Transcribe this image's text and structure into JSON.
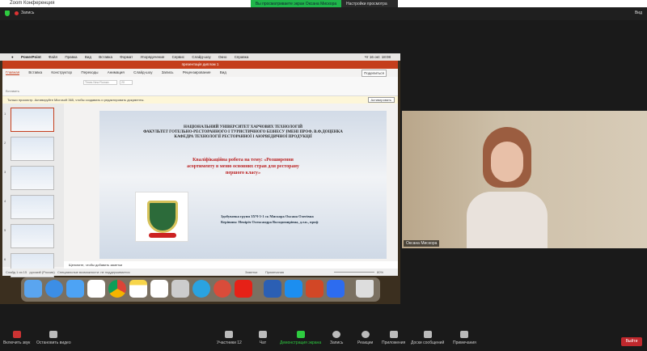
{
  "window": {
    "title": "Zoom Конференция",
    "recording": "Запись",
    "view": "Вид",
    "banner": "Вы просматриваете экран Оксана Мискора",
    "view_options": "Настройки просмотра"
  },
  "mac_menu": [
    "PowerPoint",
    "Файл",
    "Правка",
    "Вид",
    "Вставка",
    "Формат",
    "Упорядочение",
    "Сервис",
    "Слайд-шоу",
    "Окно",
    "Справка"
  ],
  "mac_clock": "Чт 16 окт. 18:08",
  "ppt": {
    "doc_title": "презентація диплом 1",
    "tabs": [
      "Главная",
      "Вставка",
      "Конструктор",
      "Переходы",
      "Анимация",
      "Слайд-шоу",
      "Запись",
      "Рецензирование",
      "Вид"
    ],
    "share": "Поделиться",
    "paste": "Вставить",
    "font": "Times New Roman",
    "font_size": "20",
    "notice": "Только просмотр. Активируйте Microsoft 365, чтобы создавать и редактировать документы.",
    "activate": "Активировать",
    "notes_placeholder": "Щелкните, чтобы добавить заметки",
    "status_left": "Слайд 1 из 15",
    "status_lang": "русский (Россия)",
    "status_access": "Специальные возможности: не поддерживается",
    "status_notes": "Заметки",
    "status_comments": "Примечания",
    "zoom": "80%"
  },
  "slide": {
    "line1": "НАЦІОНАЛЬНИЙ УНІВЕРСИТЕТ ХАРЧОВИХ ТЕХНОЛОГІЙ",
    "line2": "ФАКУЛЬТЕТ ГОТЕЛЬНО-РЕСТОРАННОГО І ТУРИСТИЧНОГО БІЗНЕСУ ІМЕНІ ПРОФ. В.Ф.ДОЦЕНКА",
    "line3": "КАФЕДРА ТЕХНОЛОГІЇ РЕСТОРАННОЇ І АЮРВЕДИЧНОЇ ПРОДУКЦІЇ",
    "title1": "Кваліфікаційна робота на тему: «Розширення",
    "title2": "асортименту в меню основних страв для ресторану",
    "title3": "першого класу»",
    "author": "Здобувачка групи ЗХЧ-3-1 ск Мискора Оксана Олегівна",
    "supervisor": "Керівник: Неніріч Олександра Володимирівна, д.т.н., проф"
  },
  "thumb_numbers": [
    "1",
    "2",
    "3",
    "4",
    "5",
    "6"
  ],
  "dock": [
    "Finder",
    "Safari",
    "Mail",
    "Reminders",
    "Chrome",
    "Notes",
    "Freeform",
    "Launchpad",
    "Telegram",
    "AnyDesk",
    "YouTube",
    "Word",
    "App Store",
    "PowerPoint",
    "Zoom",
    "Trash"
  ],
  "camera": {
    "name": "Оксана Мискора"
  },
  "toolbar": {
    "mute": "Включить звук",
    "video": "Остановить видео",
    "participants": "Участники",
    "participants_count": "12",
    "chat": "Чат",
    "share": "Демонстрация экрана",
    "record": "Запись",
    "reactions": "Реакции",
    "apps": "Приложения",
    "whiteboard": "Доски сообщений",
    "notes": "Примечания",
    "leave": "Выйти"
  }
}
